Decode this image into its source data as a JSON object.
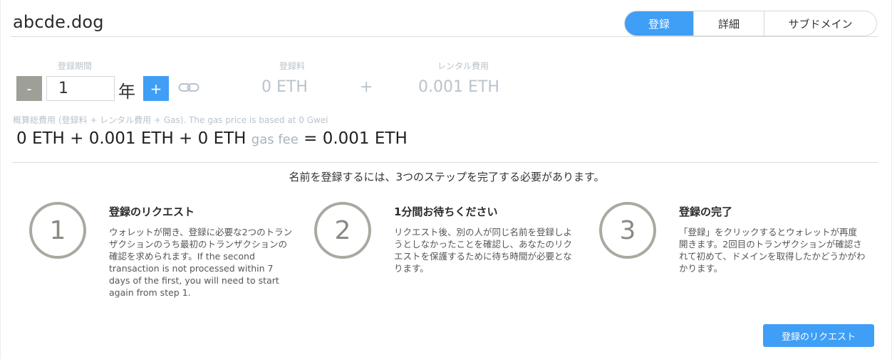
{
  "header": {
    "domain_name": "abcde.dog",
    "tabs": [
      {
        "label": "登録",
        "active": true
      },
      {
        "label": "詳細",
        "active": false
      },
      {
        "label": "サブドメイン",
        "active": false
      }
    ]
  },
  "pricing": {
    "period_label": "登録期間",
    "period_value": "1",
    "period_unit": "年",
    "minus_label": "-",
    "plus_label": "+",
    "registration_fee_label": "登録料",
    "registration_fee_value": "0 ETH",
    "plus_separator": "+",
    "rental_fee_label": "レンタル費用",
    "rental_fee_value": "0.001 ETH"
  },
  "estimate": {
    "label": "概算総費用 (登録料 + レンタル費用 + Gas). The gas price is based at 0 Gwei",
    "total_prefix": "0 ETH + 0.001 ETH + 0 ETH",
    "gas_fee_label": "gas fee",
    "total_suffix": "= 0.001 ETH"
  },
  "steps": {
    "intro": "名前を登録するには、3つのステップを完了する必要があります。",
    "items": [
      {
        "number": "1",
        "title": "登録のリクエスト",
        "text": "ウォレットが開き、登録に必要な2つのトランザクションのうち最初のトランザクションの確認を求められます。If the second transaction is not processed within 7 days of the first, you will need to start again from step 1."
      },
      {
        "number": "2",
        "title": "1分間お待ちください",
        "text": "リクエスト後、別の人が同じ名前を登録しようとしなかったことを確認し、あなたのリクエストを保護するために待ち時間が必要となります。"
      },
      {
        "number": "3",
        "title": "登録の完了",
        "text": "「登録」をクリックするとウォレットが再度開きます。2回目のトランザクションが確認されて初めて、ドメインを取得したかどうかがわかります。"
      }
    ]
  },
  "action": {
    "submit_label": "登録のリクエスト"
  },
  "colors": {
    "accent": "#3f9ef5",
    "minus_button": "#9e9f96",
    "muted_text": "#b9c3cc",
    "step_circle": "#a9a9a1"
  },
  "icons": {
    "link": "link-icon"
  }
}
